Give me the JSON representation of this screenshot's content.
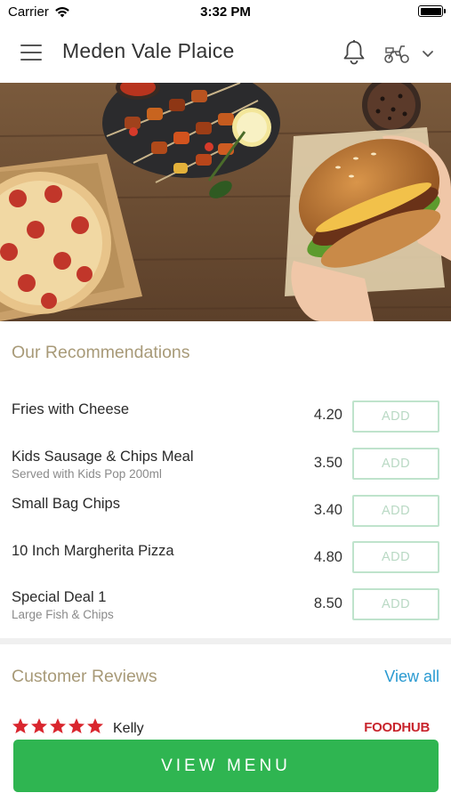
{
  "status_bar": {
    "carrier": "Carrier",
    "time": "3:32 PM",
    "icons": [
      "wifi-icon",
      "battery-icon"
    ]
  },
  "header": {
    "title": "Meden Vale Plaice",
    "menu_icon": "hamburger-icon",
    "bell_icon": "bell-icon",
    "delivery_icon": "scooter-icon",
    "dropdown_icon": "chevron-down-icon"
  },
  "hero": {
    "image": "food-banner-pizza-kebab-burger"
  },
  "recommendations": {
    "title": "Our Recommendations",
    "add_label": "ADD",
    "items": [
      {
        "name": "Fries with Cheese",
        "subtitle": "",
        "price": "4.20"
      },
      {
        "name": "Kids Sausage & Chips Meal",
        "subtitle": "Served with Kids Pop 200ml",
        "price": "3.50"
      },
      {
        "name": "Small Bag Chips",
        "subtitle": "",
        "price": "3.40"
      },
      {
        "name": "10 Inch Margherita Pizza",
        "subtitle": "",
        "price": "4.80"
      },
      {
        "name": "Special Deal 1",
        "subtitle": "Large Fish & Chips",
        "price": "8.50"
      }
    ]
  },
  "reviews": {
    "title": "Customer Reviews",
    "view_all": "View all",
    "first_review": {
      "rating": 5,
      "reviewer": "Kelly",
      "source": "FOODHUB"
    }
  },
  "footer": {
    "view_menu": "VIEW MENU"
  },
  "colors": {
    "accent_green": "#2fb551",
    "add_border": "#bfe3cc",
    "section_title": "#a89a78",
    "link_blue": "#2a9ad1",
    "star_red": "#d9262e"
  }
}
